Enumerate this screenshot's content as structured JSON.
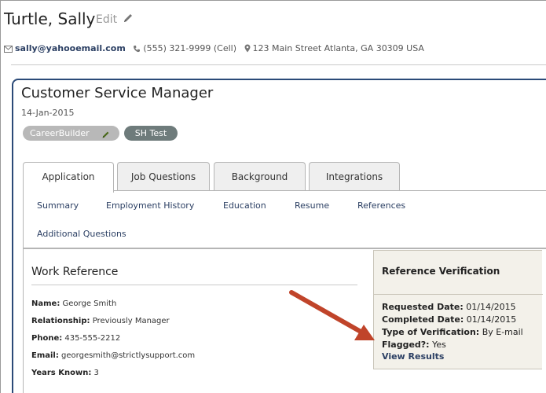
{
  "candidate": {
    "name": "Turtle, Sally",
    "edit_label": "Edit",
    "email": "sally@yahooemail.com",
    "phone": "(555) 321-9999 (Cell)",
    "address": "123 Main Street Atlanta, GA 30309 USA"
  },
  "job": {
    "title": "Customer Service Manager",
    "date": "14-Jan-2015",
    "tags": [
      {
        "label": "CareerBuilder"
      },
      {
        "label": "SH Test"
      }
    ]
  },
  "tabs": [
    {
      "label": "Application",
      "active": true
    },
    {
      "label": "Job Questions",
      "active": false
    },
    {
      "label": "Background",
      "active": false
    },
    {
      "label": "Integrations",
      "active": false
    }
  ],
  "subnav": [
    "Summary",
    "Employment History",
    "Education",
    "Resume",
    "References",
    "Additional Questions"
  ],
  "work_reference": {
    "title": "Work Reference",
    "fields": [
      {
        "label": "Name:",
        "value": "George Smith"
      },
      {
        "label": "Relationship:",
        "value": "Previously Manager"
      },
      {
        "label": "Phone:",
        "value": "435-555-2212"
      },
      {
        "label": "Email:",
        "value": "georgesmith@strictlysupport.com"
      },
      {
        "label": "Years Known:",
        "value": "3"
      }
    ]
  },
  "verification": {
    "title": "Reference Verification",
    "fields": [
      {
        "label": "Requested Date:",
        "value": "01/14/2015"
      },
      {
        "label": "Completed Date:",
        "value": "01/14/2015"
      },
      {
        "label": "Type of Verification:",
        "value": "By E-mail"
      },
      {
        "label": "Flagged?:",
        "value": "Yes"
      }
    ],
    "link": "View Results"
  },
  "icons": {
    "edit": "pencil-icon",
    "email": "envelope-icon",
    "phone": "phone-icon",
    "address": "map-pin-icon"
  },
  "colors": {
    "card_border": "#2b4a78",
    "link": "#2b3f63",
    "arrow": "#c0442a",
    "panel_bg": "#f3f1ea"
  }
}
